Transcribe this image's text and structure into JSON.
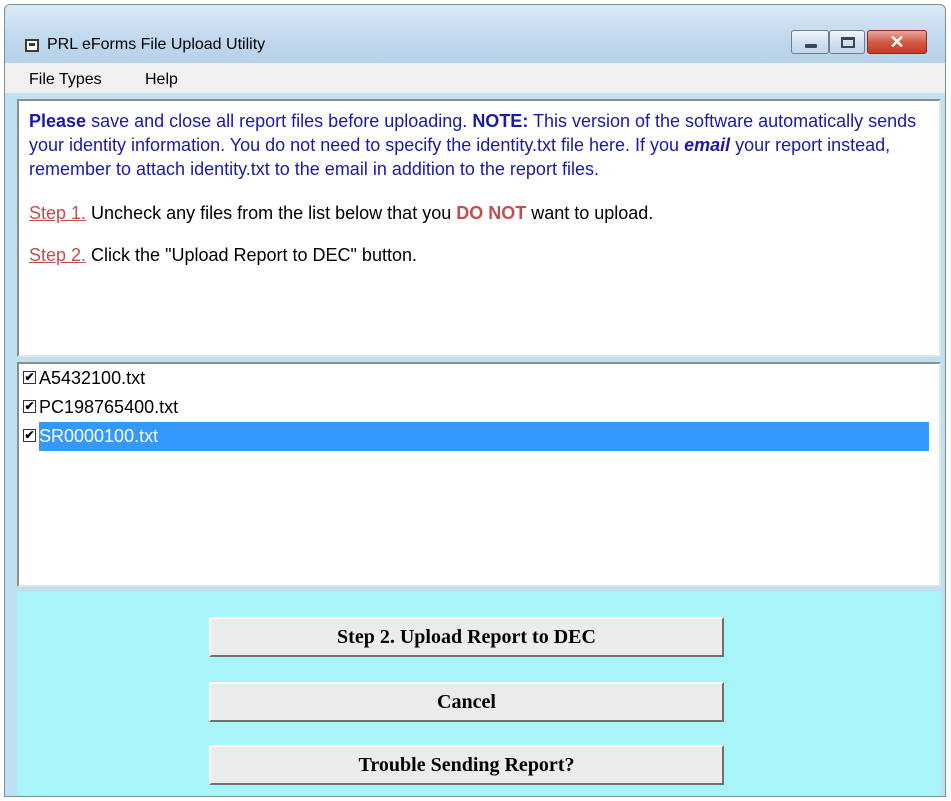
{
  "window": {
    "title": "PRL eForms File Upload Utility",
    "icon": "app-window-icon",
    "controls": {
      "minimize": "minimize-icon",
      "maximize": "maximize-icon",
      "close_label": "✕"
    }
  },
  "menu": {
    "items": [
      "File Types",
      "Help"
    ]
  },
  "instructions": {
    "intro_bold": "Please",
    "intro_text": " save and close all report files before uploading. ",
    "note_label": "NOTE:",
    "note_text": " This version of the software automatically sends your identity information. You do not need to specify the identity.txt file here. If you ",
    "email_word": "email",
    "tail_text": " your report instead, remember to attach identity.txt to the email in addition to the report files.",
    "step1_link": "Step 1.",
    "step1_pre": "  Uncheck any files from the list below that you ",
    "step1_emph": "DO NOT",
    "step1_post": " want to upload.",
    "step2_link": "Step 2.",
    "step2_text": "  Click the \"Upload Report to DEC\" button."
  },
  "files": [
    {
      "name": "A5432100.txt",
      "checked": true,
      "selected": false
    },
    {
      "name": "PC198765400.txt",
      "checked": true,
      "selected": false
    },
    {
      "name": "SR0000100.txt",
      "checked": true,
      "selected": true
    }
  ],
  "buttons": {
    "upload": "Step 2. Upload Report to DEC",
    "cancel": "Cancel",
    "trouble": "Trouble Sending Report?"
  },
  "colors": {
    "bottom_panel": "#a8f5f9",
    "text_blue": "#1a1aa6",
    "text_red": "#c0504d",
    "selection": "#3399ff"
  }
}
